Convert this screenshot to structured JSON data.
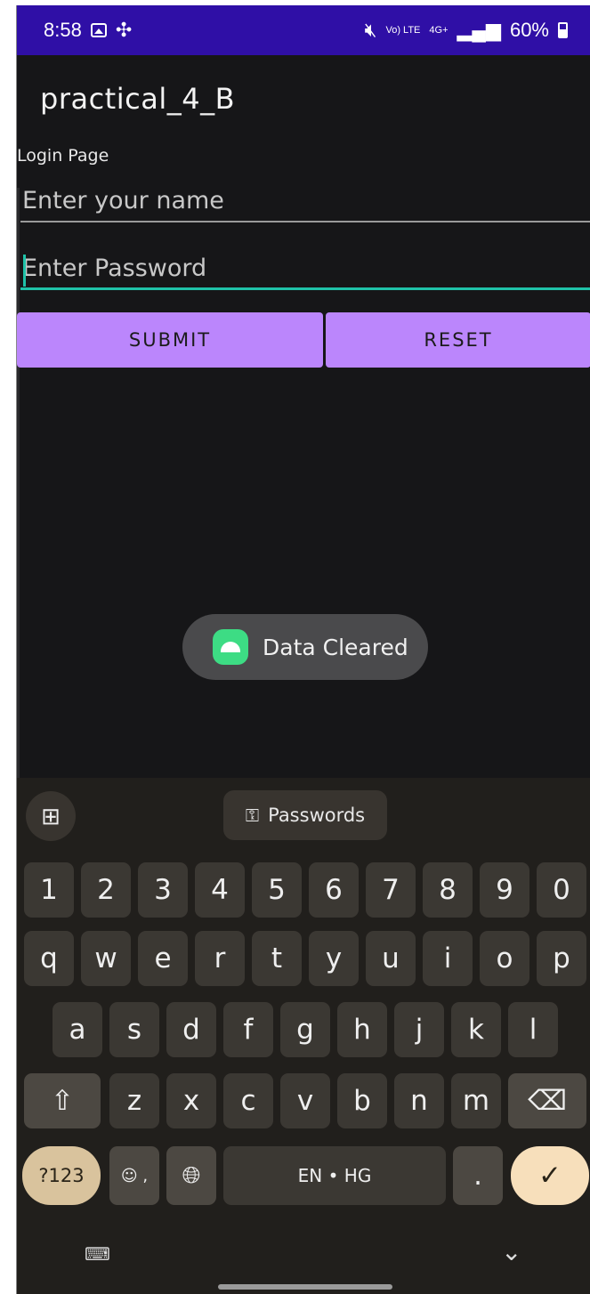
{
  "status_bar": {
    "time": "8:58",
    "volte": "Vo) LTE",
    "net": "4G+",
    "battery": "60%"
  },
  "app": {
    "title": "practical_4_B",
    "page_label": "Login Page",
    "name_placeholder": "Enter your name",
    "password_placeholder": "Enter Password",
    "submit_label": "SUBMIT",
    "reset_label": "RESET"
  },
  "toast": {
    "text": "Data Cleared"
  },
  "keyboard": {
    "passwords_label": "Passwords",
    "row_numbers": [
      "1",
      "2",
      "3",
      "4",
      "5",
      "6",
      "7",
      "8",
      "9",
      "0"
    ],
    "row_top": [
      "q",
      "w",
      "e",
      "r",
      "t",
      "y",
      "u",
      "i",
      "o",
      "p"
    ],
    "row_mid": [
      "a",
      "s",
      "d",
      "f",
      "g",
      "h",
      "j",
      "k",
      "l"
    ],
    "row_bottom": [
      "z",
      "x",
      "c",
      "v",
      "b",
      "n",
      "m"
    ],
    "sym_label": "?123",
    "space_label": "EN • HG",
    "period_label": ".",
    "emoji_comma": "☺ ,"
  },
  "colors": {
    "status_bar": "#2f0fa6",
    "button": "#bb86fc",
    "accent": "#1fc2a8"
  }
}
